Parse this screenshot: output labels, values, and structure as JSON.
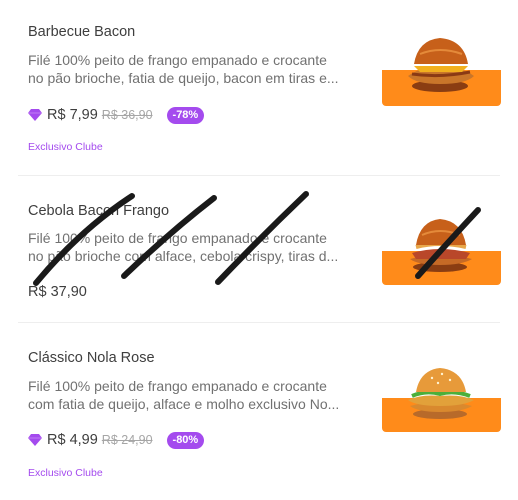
{
  "products": [
    {
      "name": "Barbecue Bacon",
      "description_lines": [
        "Filé 100% peito de frango empanado e crocante",
        "no pão brioche, fatia de queijo, bacon em tiras e..."
      ],
      "price": "R$ 7,99",
      "old_price": "R$ 36,90",
      "discount": "-78%",
      "badge": "Exclusivo Clube",
      "image_icon": "burger-photo"
    },
    {
      "name": "Cebola Bacon Frango",
      "description_lines": [
        "Filé 100% peito de frango empanado e crocante",
        "no pão brioche com alface, cebola crispy, tiras d..."
      ],
      "price": "R$ 37,90",
      "image_icon": "burger-photo",
      "scribbled_out": true
    },
    {
      "name": "Clássico Nola Rose",
      "description_lines": [
        "Filé 100% peito de frango empanado e crocante",
        "com fatia de queijo, alface e molho exclusivo No..."
      ],
      "price": "R$ 4,99",
      "old_price": "R$ 24,90",
      "discount": "-80%",
      "badge": "Exclusivo Clube",
      "image_icon": "burger-photo"
    }
  ],
  "colors": {
    "accent_purple": "#a44bee",
    "image_orange": "#ff8b1a",
    "text_dark": "#3e3e3e",
    "text_muted": "#717171",
    "strike_grey": "#a6a6a6",
    "scribble_ink": "#1a1a1a"
  },
  "icons": {
    "club_gem": "diamond-icon"
  }
}
